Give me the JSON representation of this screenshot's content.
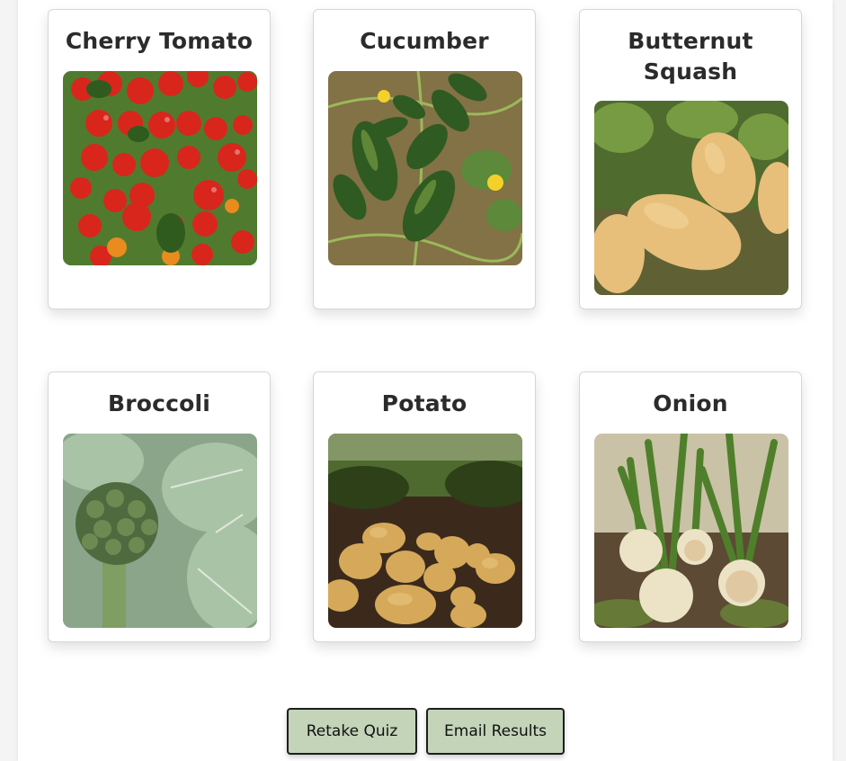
{
  "cards": [
    {
      "name": "Cherry Tomato"
    },
    {
      "name": "Cucumber"
    },
    {
      "name": "Butternut Squash"
    },
    {
      "name": "Broccoli"
    },
    {
      "name": "Potato"
    },
    {
      "name": "Onion"
    }
  ],
  "actions": {
    "retake_label": "Retake Quiz",
    "email_label": "Email Results"
  },
  "colors": {
    "button_bg": "#c3d4b8",
    "button_border": "#1e1e1e",
    "card_border": "#d6d6d6",
    "title_text": "#2b2b2b"
  }
}
